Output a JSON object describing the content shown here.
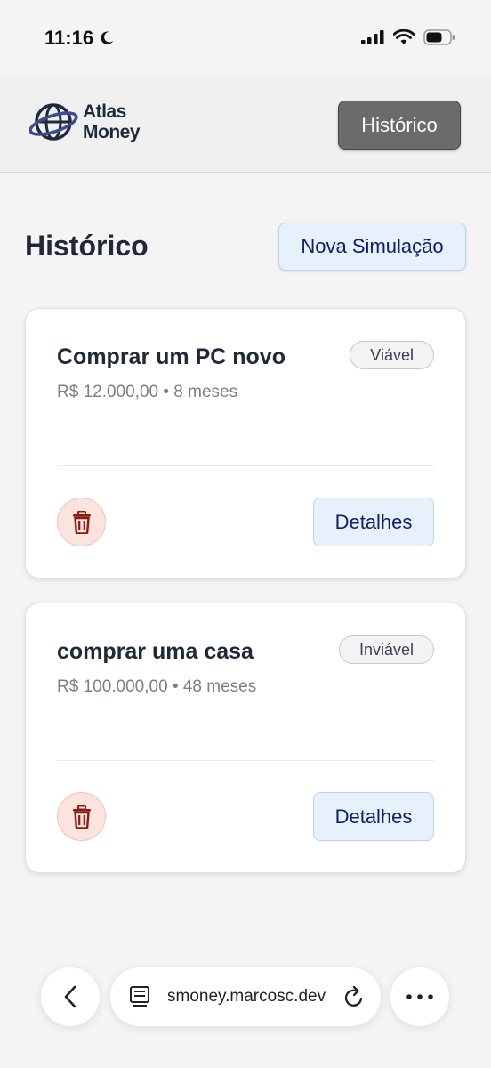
{
  "status_bar": {
    "time": "11:16"
  },
  "header": {
    "logo_line1": "Atlas",
    "logo_line2": "Money",
    "history_button": "Histórico"
  },
  "page": {
    "title": "Histórico",
    "new_simulation_button": "Nova Simulação"
  },
  "simulations": [
    {
      "title": "Comprar um PC novo",
      "summary": "R$ 12.000,00 • 8 meses",
      "status": "Viável",
      "details_button": "Detalhes"
    },
    {
      "title": "comprar uma casa",
      "summary": "R$ 100.000,00 • 48 meses",
      "status": "Inviável",
      "details_button": "Detalhes"
    }
  ],
  "browser": {
    "url": "smoney.marcosc.dev"
  },
  "icons": {
    "status": [
      "moon-icon",
      "signal-icon",
      "wifi-icon",
      "battery-icon"
    ],
    "card_delete": "trash-icon",
    "browser": [
      "back-icon",
      "reader-icon",
      "reload-icon",
      "more-icon"
    ]
  },
  "colors": {
    "primary_text": "#1f2937",
    "accent_button_bg": "#e6f1fc",
    "accent_button_text": "#0f1e6b",
    "header_button_bg": "#6b6b6b",
    "delete_bg": "#fbe3de",
    "delete_icon": "#8b1a10"
  }
}
